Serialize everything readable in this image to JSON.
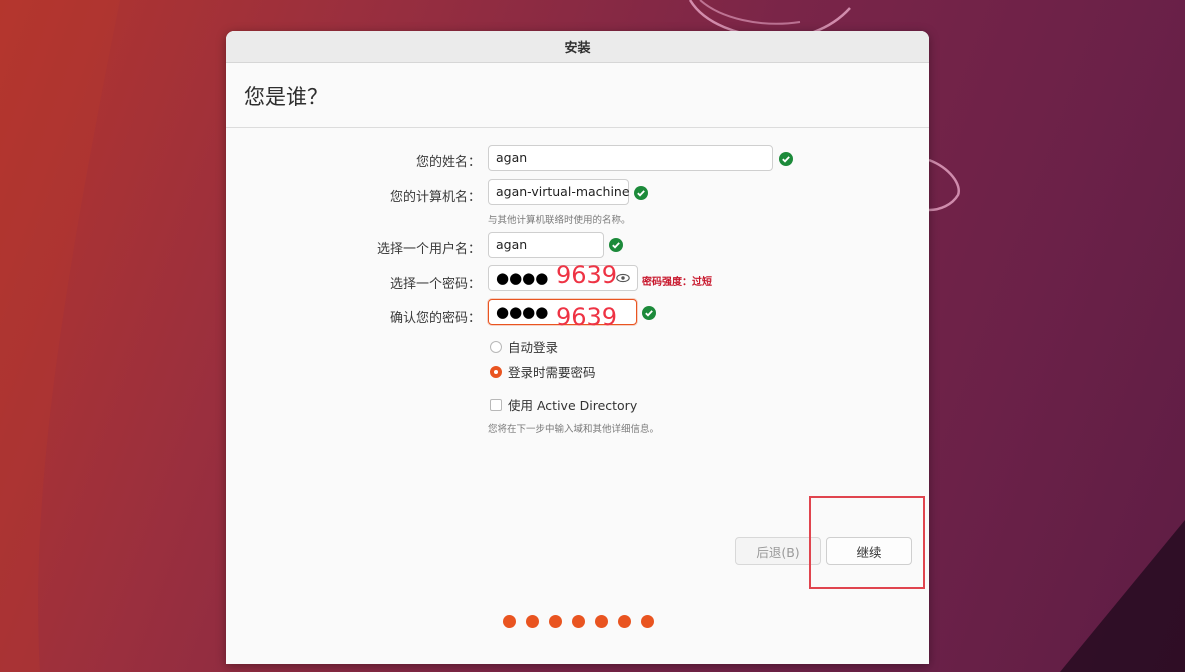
{
  "window": {
    "title": "安装"
  },
  "page": {
    "heading": "您是谁？"
  },
  "form": {
    "name_label": "您的姓名：",
    "name_value": "agan",
    "computer_label": "您的计算机名：",
    "computer_value": "agan-virtual-machine",
    "computer_hint": "与其他计算机联络时使用的名称。",
    "username_label": "选择一个用户名：",
    "username_value": "agan",
    "password_label": "选择一个密码：",
    "password_mask": "●●●●",
    "password_strength": "密码强度：过短",
    "confirm_label": "确认您的密码：",
    "confirm_mask": "●●●●"
  },
  "annotations": {
    "password_note": "9639",
    "confirm_note": "9639"
  },
  "login_options": {
    "auto_login": "自动登录",
    "require_password": "登录时需要密码",
    "selected": "require_password"
  },
  "active_directory": {
    "label": "使用 Active Directory",
    "checked": false,
    "hint": "您将在下一步中输入域和其他详细信息。"
  },
  "buttons": {
    "back": "后退(B)",
    "continue": "继续"
  },
  "progress": {
    "completed_steps": 7,
    "total_steps": 7
  },
  "colors": {
    "accent": "#e95420",
    "valid": "#1c8a3a",
    "error": "#c7162b",
    "annotation": "#ee3344"
  },
  "icons": {
    "valid": "check-circle-icon",
    "reveal": "eye-icon"
  }
}
